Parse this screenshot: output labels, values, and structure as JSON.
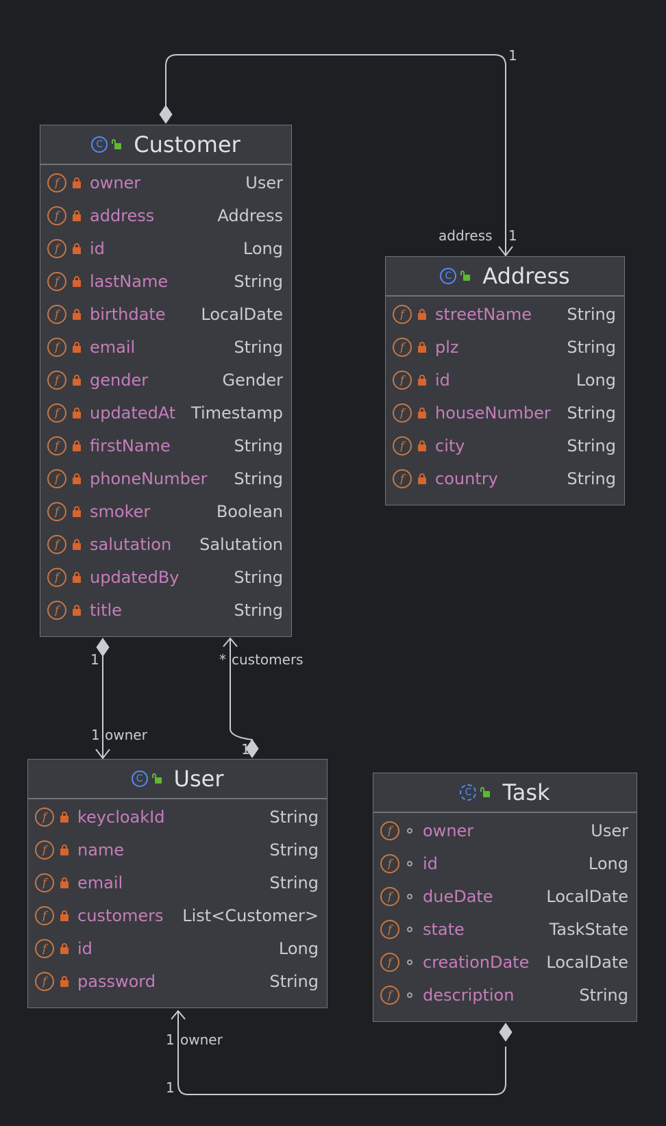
{
  "classes": {
    "customer": {
      "name": "Customer",
      "fields": [
        {
          "name": "owner",
          "type": "User"
        },
        {
          "name": "address",
          "type": "Address"
        },
        {
          "name": "id",
          "type": "Long"
        },
        {
          "name": "lastName",
          "type": "String"
        },
        {
          "name": "birthdate",
          "type": "LocalDate"
        },
        {
          "name": "email",
          "type": "String"
        },
        {
          "name": "gender",
          "type": "Gender"
        },
        {
          "name": "updatedAt",
          "type": "Timestamp"
        },
        {
          "name": "firstName",
          "type": "String"
        },
        {
          "name": "phoneNumber",
          "type": "String"
        },
        {
          "name": "smoker",
          "type": "Boolean"
        },
        {
          "name": "salutation",
          "type": "Salutation"
        },
        {
          "name": "updatedBy",
          "type": "String"
        },
        {
          "name": "title",
          "type": "String"
        }
      ]
    },
    "address": {
      "name": "Address",
      "fields": [
        {
          "name": "streetName",
          "type": "String"
        },
        {
          "name": "plz",
          "type": "String"
        },
        {
          "name": "id",
          "type": "Long"
        },
        {
          "name": "houseNumber",
          "type": "String"
        },
        {
          "name": "city",
          "type": "String"
        },
        {
          "name": "country",
          "type": "String"
        }
      ]
    },
    "user": {
      "name": "User",
      "fields": [
        {
          "name": "keycloakId",
          "type": "String"
        },
        {
          "name": "name",
          "type": "String"
        },
        {
          "name": "email",
          "type": "String"
        },
        {
          "name": "customers",
          "type": "List<Customer>"
        },
        {
          "name": "id",
          "type": "Long"
        },
        {
          "name": "password",
          "type": "String"
        }
      ]
    },
    "task": {
      "name": "Task",
      "fields": [
        {
          "name": "owner",
          "type": "User"
        },
        {
          "name": "id",
          "type": "Long"
        },
        {
          "name": "dueDate",
          "type": "LocalDate"
        },
        {
          "name": "state",
          "type": "TaskState"
        },
        {
          "name": "creationDate",
          "type": "LocalDate"
        },
        {
          "name": "description",
          "type": "String"
        }
      ]
    }
  },
  "icons": {
    "class_glyph": "C",
    "field_glyph": "f"
  },
  "edge_labels": {
    "customer_address_source_mult": "1",
    "customer_address_target_role": "address",
    "customer_address_target_mult": "1",
    "customer_user_source_mult": "1",
    "customer_user_target_mult": "1",
    "customer_user_target_role": "owner",
    "user_customers_target_mult": "*",
    "user_customers_target_role": "customers",
    "user_customers_source_mult": "1",
    "task_user_target_mult": "1",
    "task_user_target_role": "owner",
    "task_user_source_mult": "1"
  },
  "colors": {
    "background": "#1e1f22",
    "box": "#393b40",
    "field_name": "#c77dbb",
    "field_icon": "#c77745",
    "private_lock": "#d6652f",
    "class_icon": "#548af7",
    "public_icon": "#5fb832",
    "edge": "#c9ccd2"
  }
}
